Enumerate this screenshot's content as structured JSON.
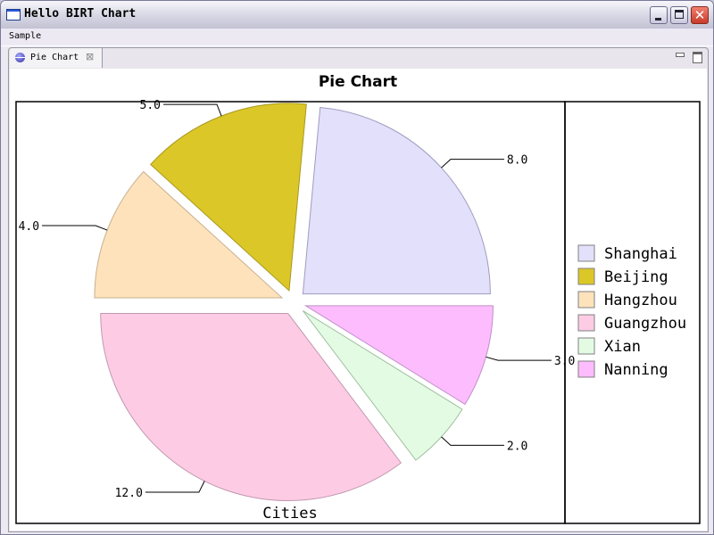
{
  "window": {
    "title": "Hello BIRT Chart",
    "close_glyph": "✕"
  },
  "menubar": {
    "items": [
      "Sample"
    ]
  },
  "view": {
    "tab_label": "Pie Chart",
    "tab_close_glyph": "⊠"
  },
  "chart_data": {
    "type": "pie",
    "title": "Pie Chart",
    "series_label": "Cities",
    "categories": [
      "Shanghai",
      "Beijing",
      "Hangzhou",
      "Guangzhou",
      "Xian",
      "Nanning"
    ],
    "values": [
      8,
      5,
      4,
      12,
      2,
      3
    ],
    "value_labels": [
      "8.0",
      "5.0",
      "4.0",
      "12.0",
      "2.0",
      "3.0"
    ],
    "colors": [
      "#e2e0fa",
      "#dcc728",
      "#fde2bb",
      "#fdcce4",
      "#e3fbe3",
      "#fdbcfe"
    ],
    "edge_colors": [
      "#a09cc0",
      "#a8981e",
      "#c8b08e",
      "#c098b0",
      "#a0c0a0",
      "#c090c8"
    ],
    "start_direction": "east",
    "rotation": "counter-clockwise",
    "exploded": true,
    "legend": {
      "position": "right",
      "entries": [
        "Shanghai",
        "Beijing",
        "Hangzhou",
        "Guangzhou",
        "Xian",
        "Nanning"
      ]
    }
  }
}
